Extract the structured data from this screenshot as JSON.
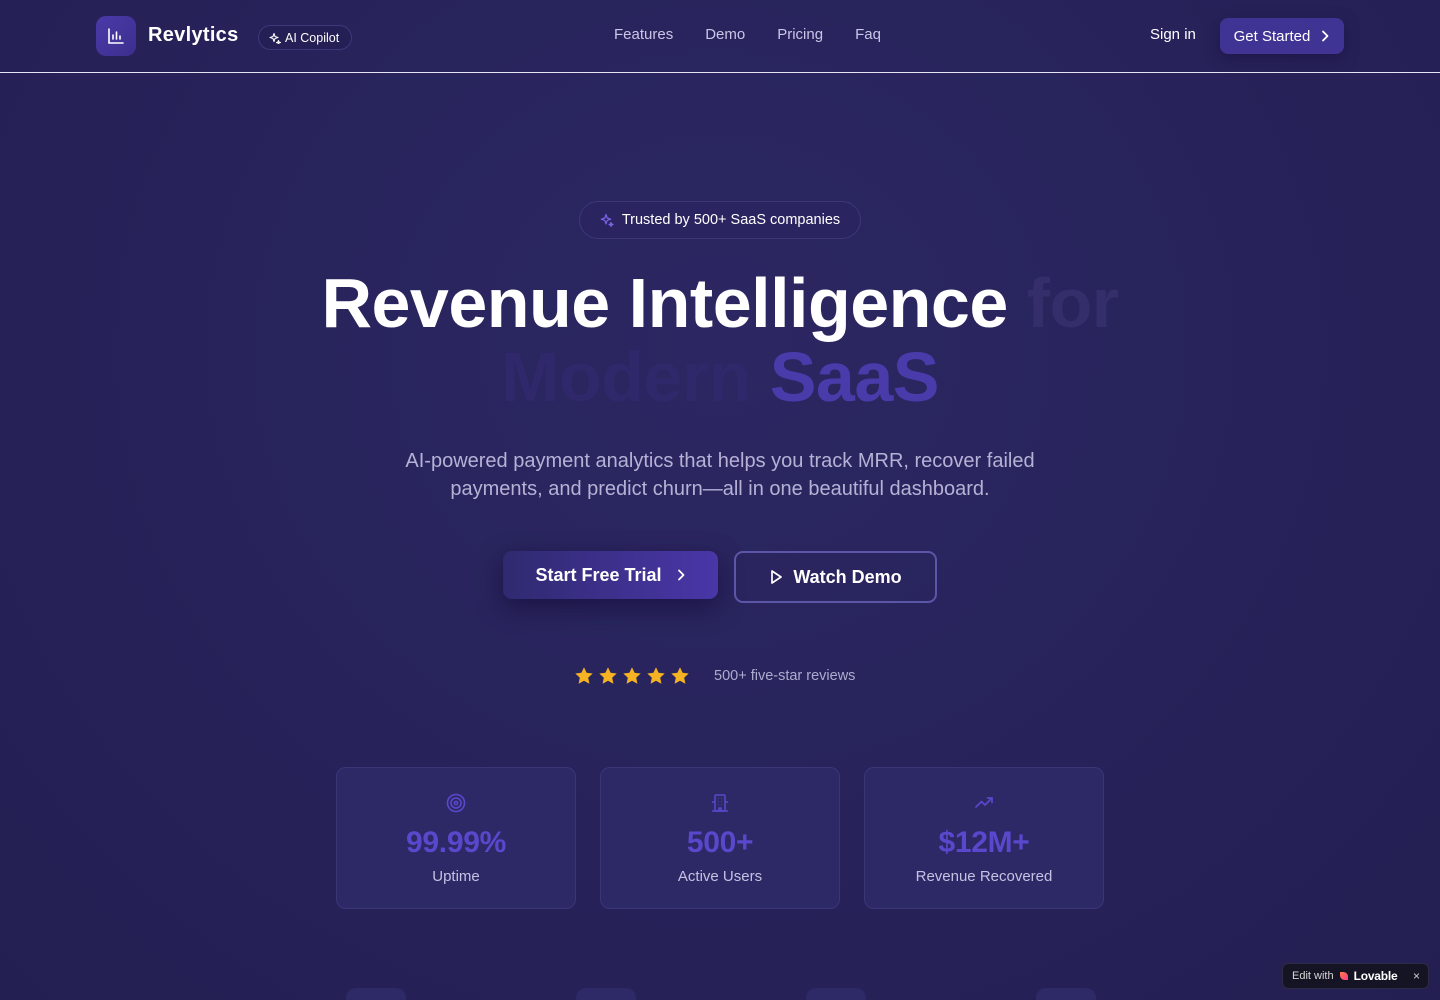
{
  "header": {
    "brand": "Revlytics",
    "badge_label": "AI Copilot",
    "nav": [
      "Features",
      "Demo",
      "Pricing",
      "Faq"
    ],
    "sign_in": "Sign in",
    "get_started": "Get Started"
  },
  "hero": {
    "trusted_badge": "Trusted by 500+ SaaS companies",
    "headline": {
      "part1": "Revenue Intelligence",
      "part2": "for",
      "part3": "Modern",
      "part4": "SaaS"
    },
    "subtitle": "AI-powered payment analytics that helps you track MRR, recover failed payments, and predict churn—all in one beautiful dashboard.",
    "primary_cta": "Start Free Trial",
    "secondary_cta": "Watch Demo",
    "rating_stars": 5,
    "reviews_text": "500+ five-star reviews"
  },
  "stats": [
    {
      "icon": "target-icon",
      "value": "99.99%",
      "label": "Uptime"
    },
    {
      "icon": "building-icon",
      "value": "500+",
      "label": "Active Users"
    },
    {
      "icon": "trending-up-icon",
      "value": "$12M+",
      "label": "Revenue Recovered"
    }
  ],
  "lovable_badge": {
    "prefix": "Edit with",
    "brand": "Lovable",
    "close": "×"
  },
  "colors": {
    "background": "#27235a",
    "accent": "#5a48cc",
    "star": "#f5b324"
  }
}
